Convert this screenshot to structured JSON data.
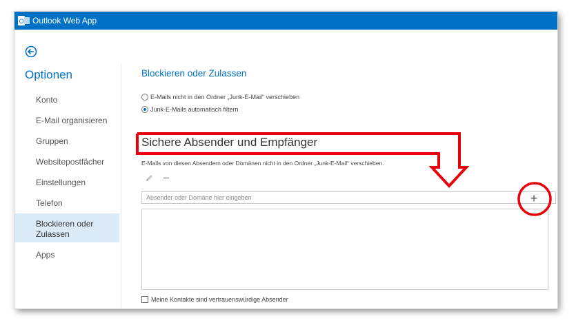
{
  "app": {
    "title": "Outlook Web App",
    "logo_letters": "O"
  },
  "sidebar": {
    "heading": "Optionen",
    "items": [
      {
        "label": "Konto"
      },
      {
        "label": "E-Mail organisieren"
      },
      {
        "label": "Gruppen"
      },
      {
        "label": "Websitepostfächer"
      },
      {
        "label": "Einstellungen"
      },
      {
        "label": "Telefon"
      },
      {
        "label": "Blockieren oder Zulassen",
        "line1": "Blockieren oder",
        "line2": "Zulassen",
        "active": true
      },
      {
        "label": "Apps"
      }
    ]
  },
  "main": {
    "title": "Blockieren oder Zulassen",
    "radios": [
      {
        "label": "E-Mails nicht in den Ordner „Junk-E-Mail“ verschieben",
        "checked": false
      },
      {
        "label": "Junk-E-Mails automatisch filtern",
        "checked": true
      }
    ],
    "safe_senders": {
      "title": "Sichere Absender und Empfänger",
      "description": "E-Mails von diesen Absendern oder Domänen nicht in den Ordner „Junk-E-Mail“ verschieben.",
      "input_placeholder": "Absender oder Domäne hier eingeben",
      "input_value": "",
      "add_symbol": "+",
      "remove_symbol": "–"
    },
    "contacts_checkbox": {
      "label": "Meine Kontakte sind vertrauenswürdige Absender",
      "checked": false
    }
  },
  "colors": {
    "accent": "#0072c6",
    "annotation": "#e8000b",
    "active_nav": "#dcebf8"
  },
  "icons": [
    "outlook-logo-icon",
    "back-arrow-icon",
    "pencil-icon",
    "minus-icon",
    "plus-icon"
  ]
}
